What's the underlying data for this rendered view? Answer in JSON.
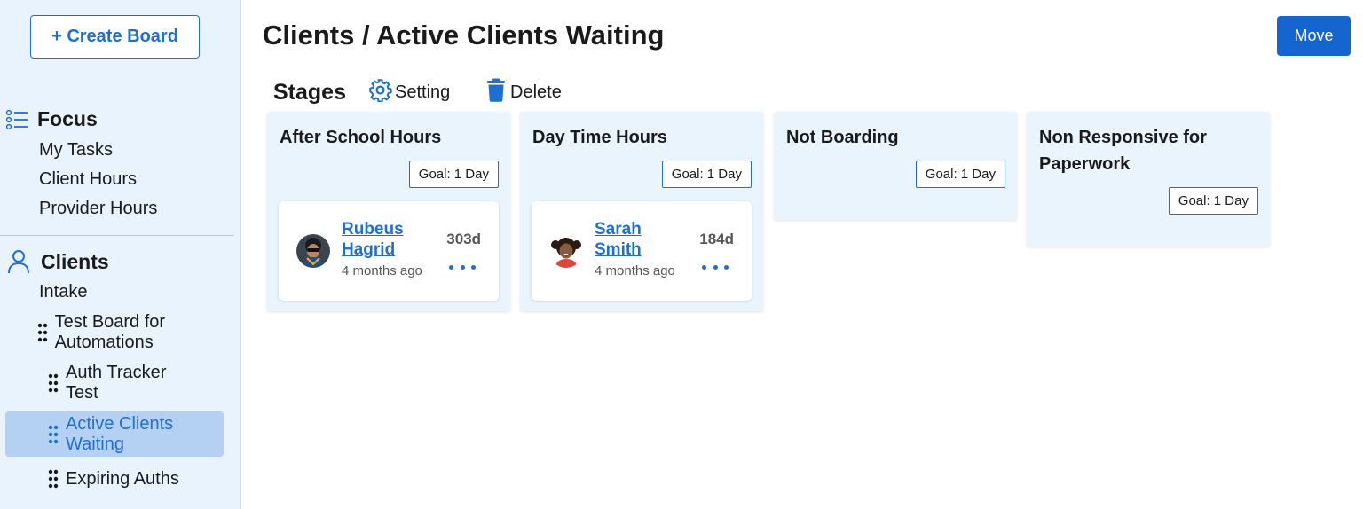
{
  "sidebar": {
    "create_board_label": "+ Create Board",
    "focus": {
      "title": "Focus",
      "items": [
        "My Tasks",
        "Client Hours",
        "Provider Hours"
      ]
    },
    "clients": {
      "title": "Clients",
      "intake_label": "Intake",
      "boards": [
        {
          "label": "Test Board for Automations",
          "active": false
        },
        {
          "label": "Auth Tracker Test",
          "active": false
        },
        {
          "label": "Active Clients Waiting",
          "active": true
        },
        {
          "label": "Expiring Auths",
          "active": false
        }
      ]
    }
  },
  "header": {
    "title": "Clients / Active Clients Waiting",
    "move_label": "Move"
  },
  "toolbar": {
    "stages_label": "Stages",
    "setting_label": "Setting",
    "delete_label": "Delete"
  },
  "columns": [
    {
      "title": "After School Hours",
      "goal": "Goal: 1 Day",
      "cards": [
        {
          "name": "Rubeus Hagrid",
          "ago": "4 months ago",
          "days": "303d"
        }
      ]
    },
    {
      "title": "Day Time Hours",
      "goal": "Goal: 1 Day",
      "cards": [
        {
          "name": "Sarah Smith",
          "ago": "4 months ago",
          "days": "184d"
        }
      ]
    },
    {
      "title": "Not Boarding",
      "goal": "Goal: 1 Day",
      "cards": []
    },
    {
      "title": "Non Responsive for Paperwork",
      "goal": "Goal: 1 Day",
      "cards": []
    }
  ],
  "colors": {
    "accent": "#1f6fd1",
    "sidebar_bg": "#e8f3fd",
    "active_item_bg": "#b4d0f3",
    "column_bg": "#eaf4fd",
    "move_button": "#1565d0"
  }
}
